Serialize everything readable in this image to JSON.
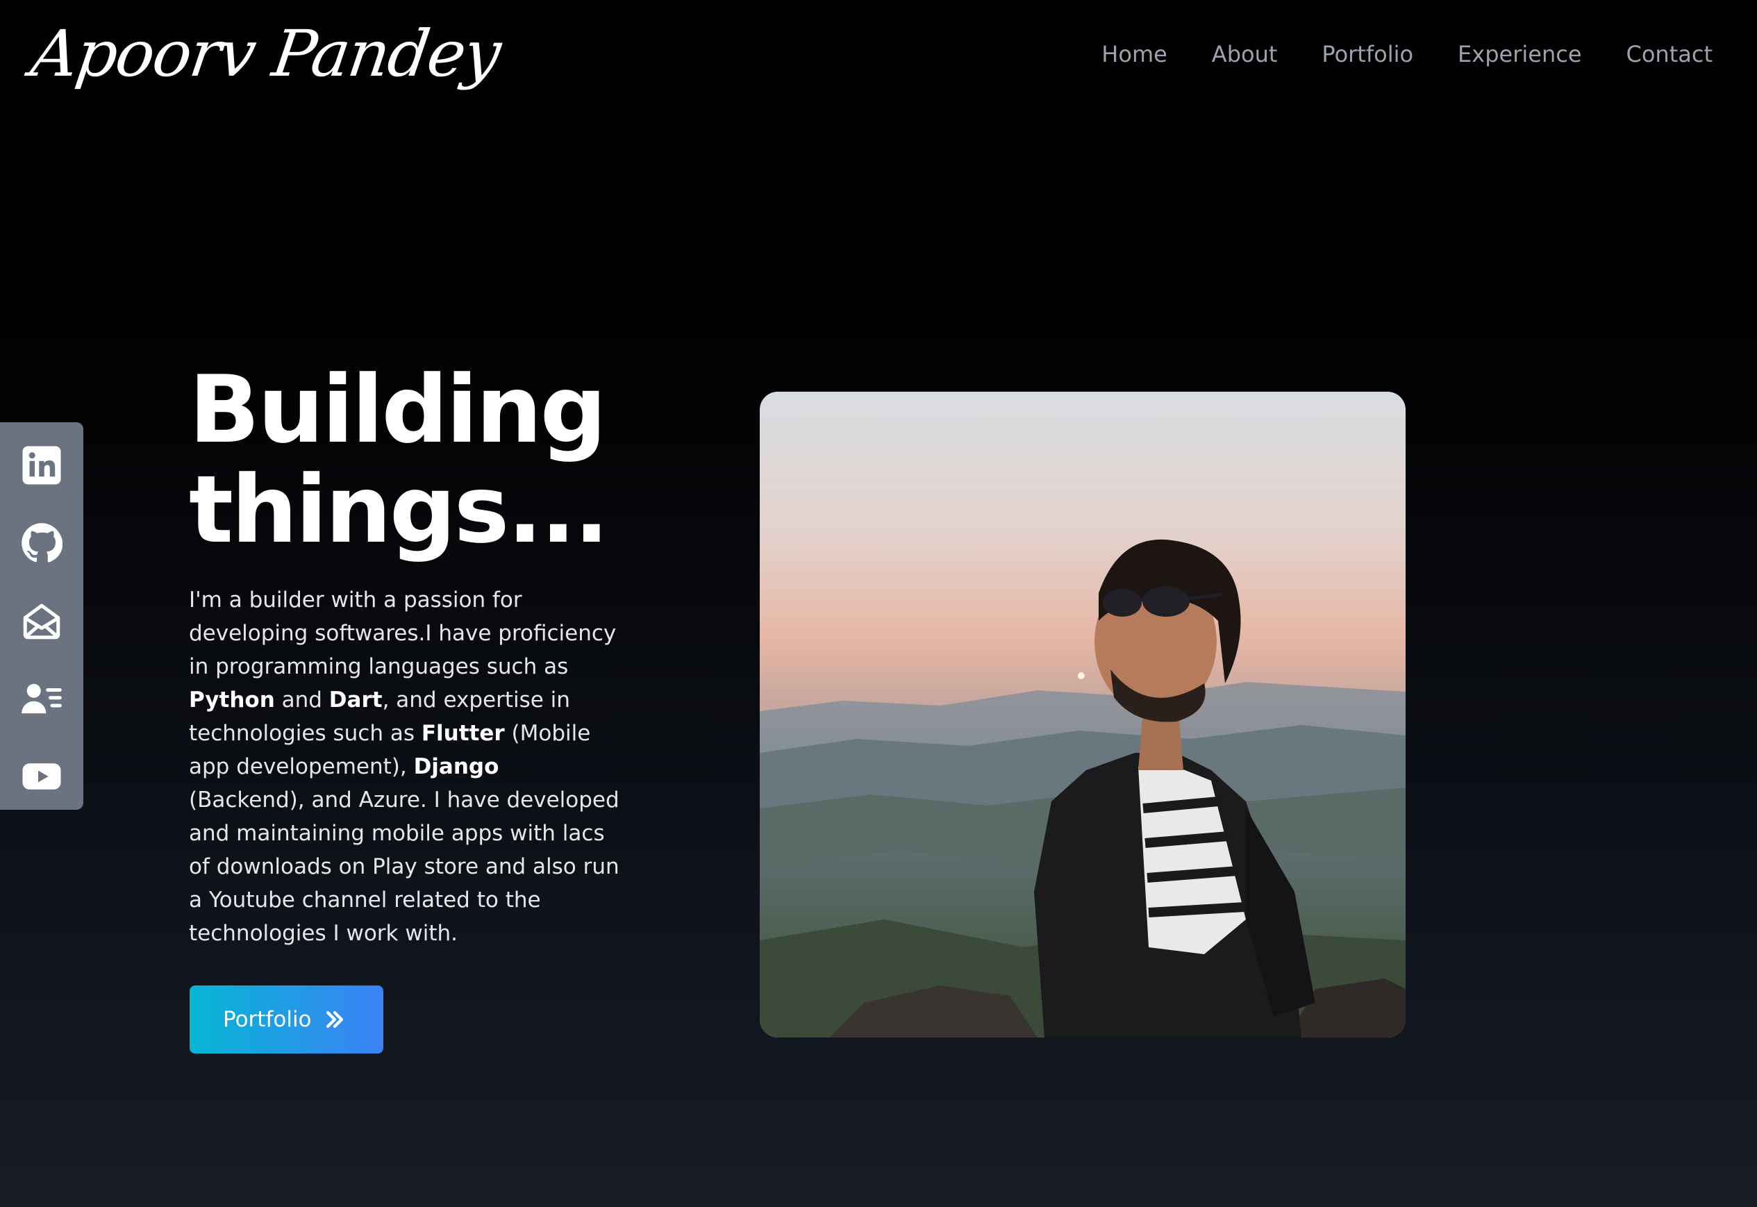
{
  "header": {
    "logo_text": "Apoorv Pandey",
    "nav": [
      {
        "label": "Home"
      },
      {
        "label": "About"
      },
      {
        "label": "Portfolio"
      },
      {
        "label": "Experience"
      },
      {
        "label": "Contact"
      }
    ]
  },
  "social": [
    {
      "icon": "linkedin-icon"
    },
    {
      "icon": "github-icon"
    },
    {
      "icon": "mail-icon"
    },
    {
      "icon": "resume-icon"
    },
    {
      "icon": "youtube-icon"
    }
  ],
  "hero": {
    "title_line1": "Building",
    "title_line2": "things...",
    "desc": [
      {
        "t": "I'm a builder with a passion for developing softwares.I have proficiency in programming languages such as ",
        "b": false
      },
      {
        "t": "Python",
        "b": true
      },
      {
        "t": " and ",
        "b": false
      },
      {
        "t": "Dart",
        "b": true
      },
      {
        "t": ", and expertise in technologies such as ",
        "b": false
      },
      {
        "t": "Flutter",
        "b": true
      },
      {
        "t": " (Mobile app developement), ",
        "b": false
      },
      {
        "t": "Django",
        "b": true
      },
      {
        "t": " (Backend), and Azure. I have developed and maintaining mobile apps with lacs of downloads on Play store and also run a Youtube channel related to the technologies I work with.",
        "b": false
      }
    ],
    "cta_label": "Portfolio",
    "cta_icon": "chevrons-right-icon"
  },
  "colors": {
    "background_top": "#000000",
    "background_bottom": "#171c27",
    "nav_text": "#9ca3af",
    "sidebar": "#6b7280",
    "cta_gradient_start": "#06b6d4",
    "cta_gradient_end": "#3b82f6"
  }
}
